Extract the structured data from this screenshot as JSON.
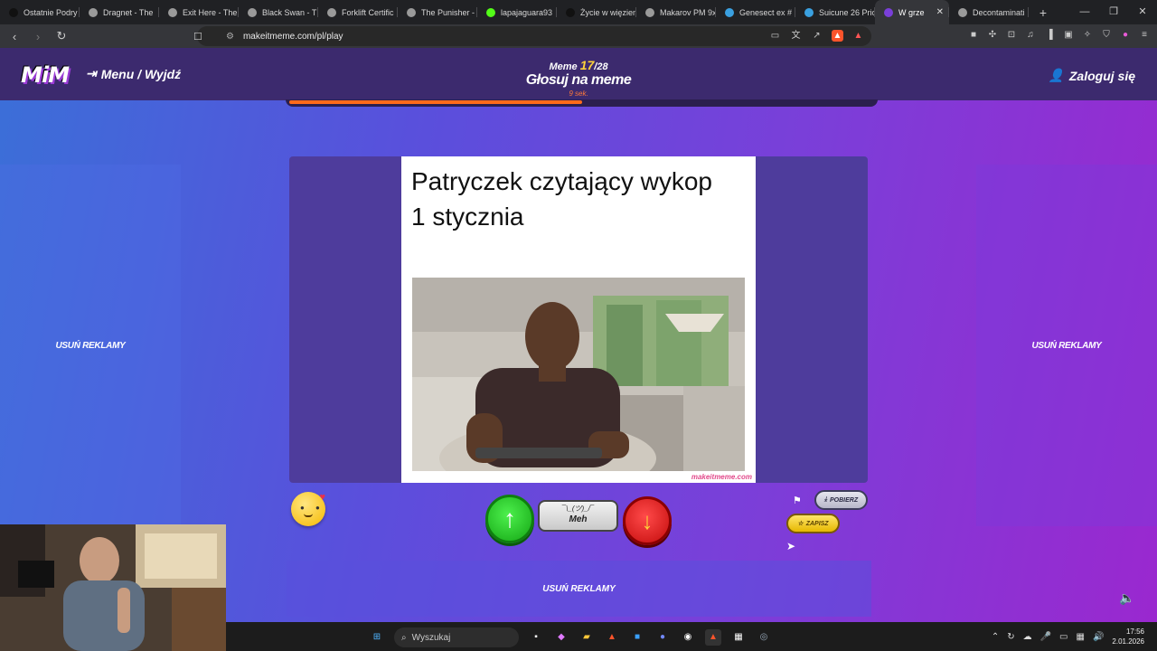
{
  "browser": {
    "tabs": [
      {
        "label": "Ostatnie Podry",
        "icon": "tiktok-icon",
        "color": "#111111"
      },
      {
        "label": "Dragnet - The",
        "icon": "openai-icon",
        "color": "#9a9a9a"
      },
      {
        "label": "Exit Here - The",
        "icon": "openai-icon",
        "color": "#9a9a9a"
      },
      {
        "label": "Black Swan - Th",
        "icon": "openai-icon",
        "color": "#9a9a9a"
      },
      {
        "label": "Forklift Certific",
        "icon": "openai-icon",
        "color": "#9a9a9a"
      },
      {
        "label": "The Punisher -",
        "icon": "openai-icon",
        "color": "#9a9a9a"
      },
      {
        "label": "lapajaguara93",
        "icon": "kick-icon",
        "color": "#53fc18"
      },
      {
        "label": "Życie w więzien",
        "icon": "tiktok-icon",
        "color": "#111111"
      },
      {
        "label": "Makarov PM 9x",
        "icon": "openai-icon",
        "color": "#9a9a9a"
      },
      {
        "label": "Genesect ex #",
        "icon": "pokemon-icon",
        "color": "#3aa0e0"
      },
      {
        "label": "Suicune 26 Pric",
        "icon": "pokemon-icon",
        "color": "#3aa0e0"
      },
      {
        "label": "W grze",
        "icon": "mim-icon",
        "color": "#7a3fd9",
        "active": true
      },
      {
        "label": "Decontaminati",
        "icon": "openai-icon",
        "color": "#9a9a9a"
      }
    ],
    "url": "makeitmeme.com/pl/play"
  },
  "site": {
    "logo": "MiM",
    "menu_label": "Menu / Wyjdź",
    "meme_label": "Meme",
    "meme_current": "17",
    "meme_total": "/28",
    "title": "Głosuj na meme",
    "seconds": "9 sek.",
    "progress": 0.5,
    "login_label": "Zaloguj się",
    "remove_ads": "USUŃ REKLAMY"
  },
  "meme": {
    "caption_line1": "Patryczek czytający wykop",
    "caption_line2": "1 stycznia",
    "watermark": "makeitmeme.com"
  },
  "vote": {
    "meh_shrug": "¯\\_(ツ)_/¯",
    "meh_label": "Meh",
    "download_label": "POBIERZ",
    "save_label": "ZAPISZ"
  },
  "taskbar": {
    "search_placeholder": "Wyszukaj",
    "time": "17:56",
    "date": "2.01.2026"
  }
}
